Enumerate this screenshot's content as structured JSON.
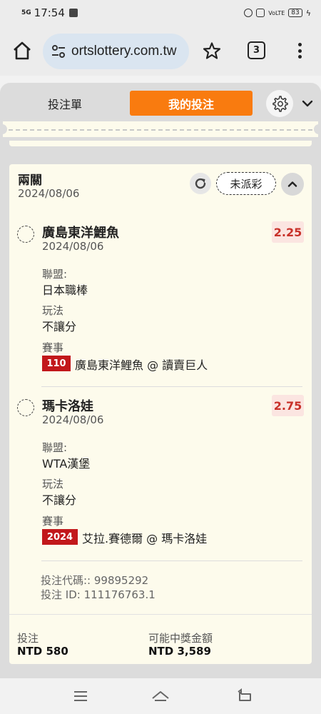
{
  "status_bar": {
    "signal": "5G",
    "time": "17:54",
    "battery": "83"
  },
  "browser": {
    "url": "ortslottery.com.tw",
    "tab_count": "3"
  },
  "tabs": {
    "bet_slip": "投注單",
    "my_bets": "我的投注"
  },
  "bet": {
    "type": "兩關",
    "date": "2024/08/06",
    "status": "未派彩",
    "selections": [
      {
        "name": "廣島東洋鯉魚",
        "date": "2024/08/06",
        "odds": "2.25",
        "league_label": "聯盟:",
        "league": "日本職棒",
        "market_label": "玩法",
        "market": "不讓分",
        "event_label": "賽事",
        "event_code": "110",
        "event": "廣島東洋鯉魚 @ 讀賣巨人"
      },
      {
        "name": "瑪卡洛娃",
        "date": "2024/08/06",
        "odds": "2.75",
        "league_label": "聯盟:",
        "league": "WTA漢堡",
        "market_label": "玩法",
        "market": "不讓分",
        "event_label": "賽事",
        "event_code": "2024",
        "event": "艾拉.賽德爾 @ 瑪卡洛娃"
      }
    ],
    "bet_code": "投注代碼:: 99895292",
    "bet_id": "投注 ID: 111176763.1",
    "stake_label": "投注",
    "stake": "NTD 580",
    "potential_label": "可能中獎金額",
    "potential": "NTD 3,589"
  },
  "colors": {
    "accent": "#f97b0f",
    "odds_text": "#c8322a",
    "code_bg": "#c2181b",
    "card_bg": "#fdfbec"
  }
}
